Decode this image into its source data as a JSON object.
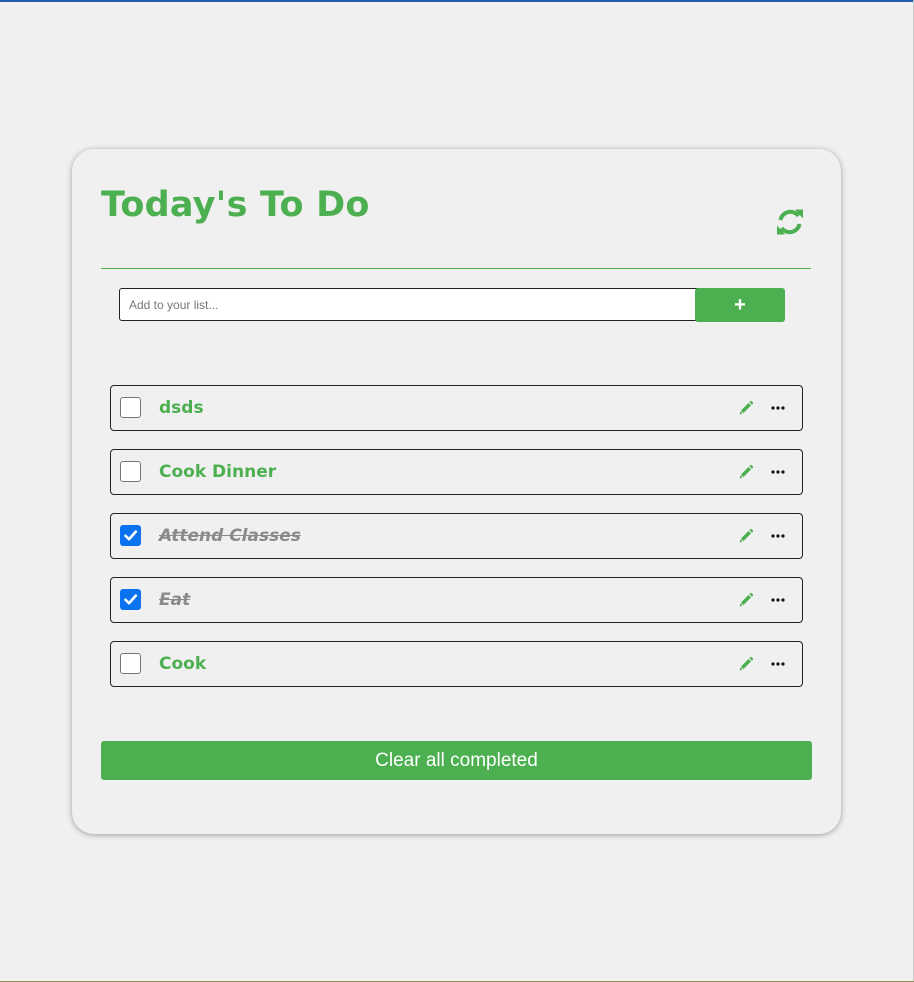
{
  "app": {
    "title": "Today's To Do",
    "refresh_icon": "refresh-icon"
  },
  "add_form": {
    "input_value": "",
    "input_placeholder": "Add to your list...",
    "add_label": "+"
  },
  "todos": [
    {
      "text": "dsds",
      "completed": false
    },
    {
      "text": "Cook Dinner",
      "completed": false
    },
    {
      "text": "Attend Classes",
      "completed": true
    },
    {
      "text": "Eat",
      "completed": true
    },
    {
      "text": "Cook",
      "completed": false
    }
  ],
  "item_icons": {
    "edit": "pencil-icon",
    "more": "more-horizontal-icon"
  },
  "footer": {
    "clear_label": "Clear all completed"
  },
  "colors": {
    "accent": "#4caf50",
    "checkbox_checked": "#0b73f0",
    "completed_text": "#8a8a8a",
    "background": "#f0f0f0"
  }
}
